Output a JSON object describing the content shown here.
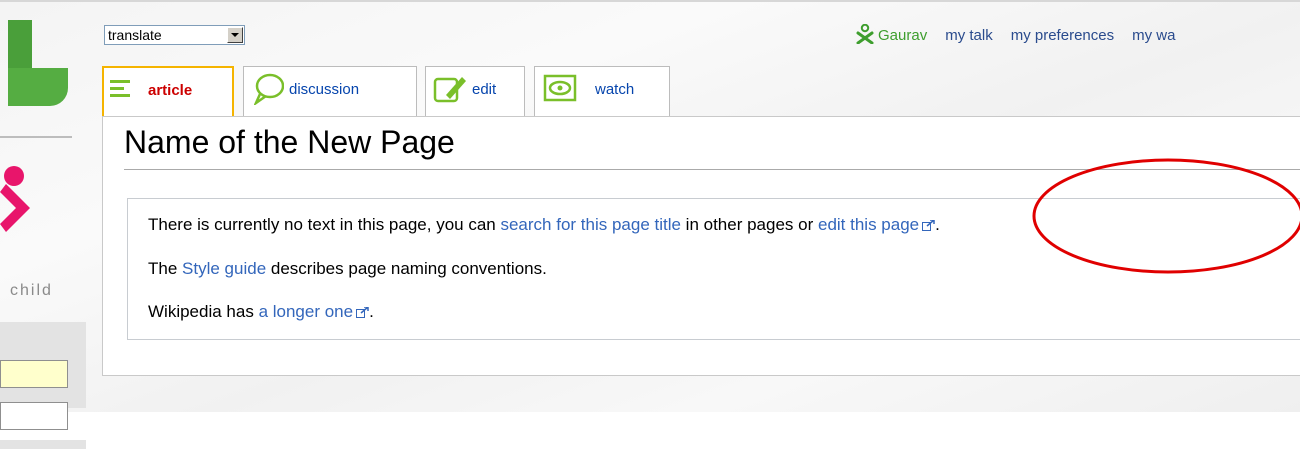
{
  "site": {
    "logo_tagline": "child"
  },
  "header": {
    "translate_select": {
      "value": "translate"
    },
    "personal_links": {
      "user_name": "Gaurav",
      "talk": "my talk",
      "preferences": "my preferences",
      "watchlist": "my wa"
    }
  },
  "tabs": [
    {
      "label": "article",
      "icon": "article-lines-icon",
      "selected": true,
      "color": "#cc0000"
    },
    {
      "label": "discussion",
      "icon": "speech-bubble-icon",
      "selected": false,
      "color": "#0645ad"
    },
    {
      "label": "edit",
      "icon": "pencil-page-icon",
      "selected": false,
      "color": "#0645ad"
    },
    {
      "label": "watch",
      "icon": "eye-icon",
      "selected": false,
      "color": "#0645ad"
    }
  ],
  "page": {
    "title": "Name of the New Page",
    "notice": {
      "line1_prefix": "There is currently no text in this page, you can ",
      "line1_link1": "search for this page title",
      "line1_middle": " in other pages or ",
      "line1_link2": "edit this page",
      "line1_suffix": ".",
      "line2_prefix": "The ",
      "line2_link": "Style guide",
      "line2_suffix": " describes page naming conventions.",
      "line3_prefix": "Wikipedia has ",
      "line3_link": "a longer one",
      "line3_suffix": "."
    }
  },
  "colors": {
    "link": "#3366bb",
    "user_link": "#3e9e2e",
    "selected_tab_border": "#f5b400",
    "annotation": "#e00000",
    "logo_green": "#4a9f3a",
    "logo_pink": "#e8156b"
  }
}
